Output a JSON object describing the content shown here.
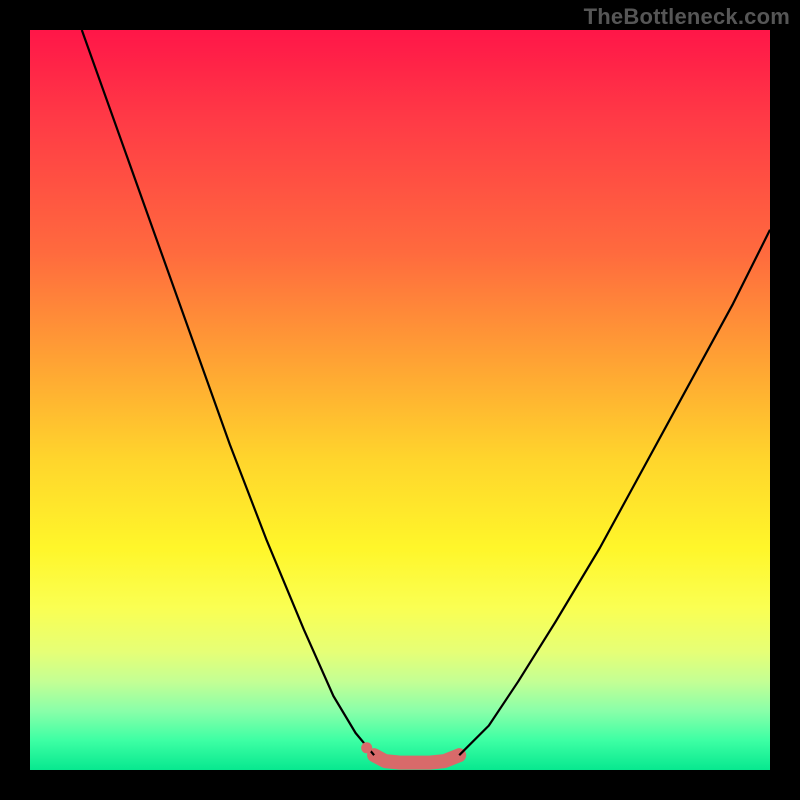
{
  "watermark": "TheBottleneck.com",
  "chart_data": {
    "type": "line",
    "title": "",
    "xlabel": "",
    "ylabel": "",
    "xlim": [
      0,
      100
    ],
    "ylim": [
      0,
      100
    ],
    "series": [
      {
        "name": "left-curve",
        "x": [
          7,
          12,
          17,
          22,
          27,
          32,
          37,
          41,
          44,
          46.5
        ],
        "y": [
          100,
          86,
          72,
          58,
          44,
          31,
          19,
          10,
          5,
          2
        ]
      },
      {
        "name": "right-curve",
        "x": [
          58,
          62,
          66,
          71,
          77,
          83,
          89,
          95,
          100
        ],
        "y": [
          2,
          6,
          12,
          20,
          30,
          41,
          52,
          63,
          73
        ]
      },
      {
        "name": "valley-fill",
        "x": [
          46.5,
          48,
          50,
          52,
          54,
          56,
          58
        ],
        "y": [
          2,
          1.2,
          1,
          1,
          1,
          1.2,
          2
        ]
      }
    ],
    "annotations": [
      {
        "name": "valley-dot",
        "x": 45.5,
        "y": 3.0
      }
    ],
    "colors": {
      "curve": "#000000",
      "valley": "#d86a6a",
      "valley_dot": "#d86a6a",
      "background_top": "#ff1648",
      "background_bottom": "#07e88f",
      "frame": "#000000"
    }
  }
}
